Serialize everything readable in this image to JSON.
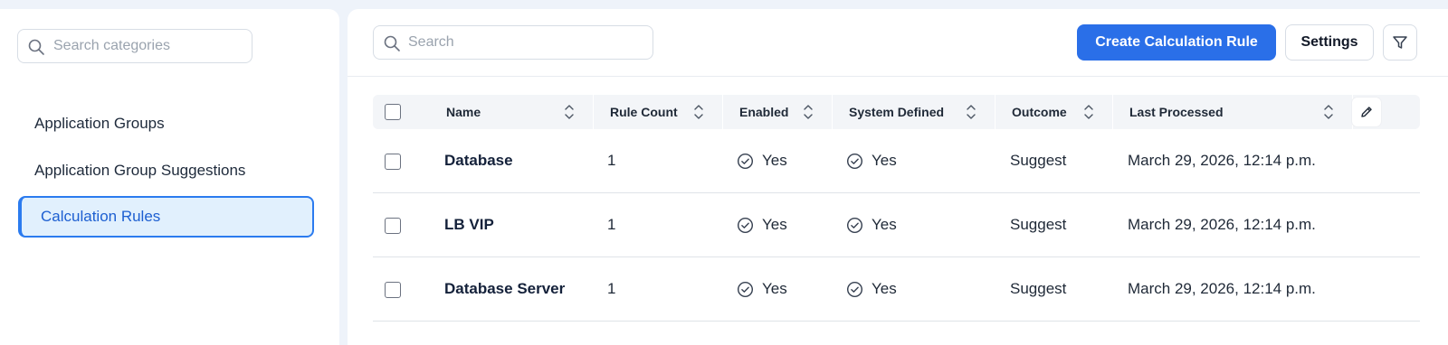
{
  "sidebar": {
    "search_placeholder": "Search categories",
    "items": [
      {
        "label": "Application Groups",
        "active": false
      },
      {
        "label": "Application Group Suggestions",
        "active": false
      },
      {
        "label": "Calculation Rules",
        "active": true
      }
    ]
  },
  "toolbar": {
    "search_placeholder": "Search",
    "create_label": "Create Calculation Rule",
    "settings_label": "Settings",
    "filter_icon": "filter-icon"
  },
  "table": {
    "columns": [
      "Name",
      "Rule Count",
      "Enabled",
      "System Defined",
      "Outcome",
      "Last Processed"
    ],
    "rows": [
      {
        "name": "Database",
        "rule_count": "1",
        "enabled": "Yes",
        "system_defined": "Yes",
        "outcome": "Suggest",
        "last_processed": "March 29, 2026, 12:14 p.m."
      },
      {
        "name": "LB VIP",
        "rule_count": "1",
        "enabled": "Yes",
        "system_defined": "Yes",
        "outcome": "Suggest",
        "last_processed": "March 29, 2026, 12:14 p.m."
      },
      {
        "name": "Database Server",
        "rule_count": "1",
        "enabled": "Yes",
        "system_defined": "Yes",
        "outcome": "Suggest",
        "last_processed": "March 29, 2026, 12:14 p.m."
      }
    ]
  },
  "colors": {
    "primary": "#2a6fe8",
    "active_bg": "#e1f0fd",
    "active_border": "#2b7bef",
    "page_bg": "#eef3fa"
  }
}
